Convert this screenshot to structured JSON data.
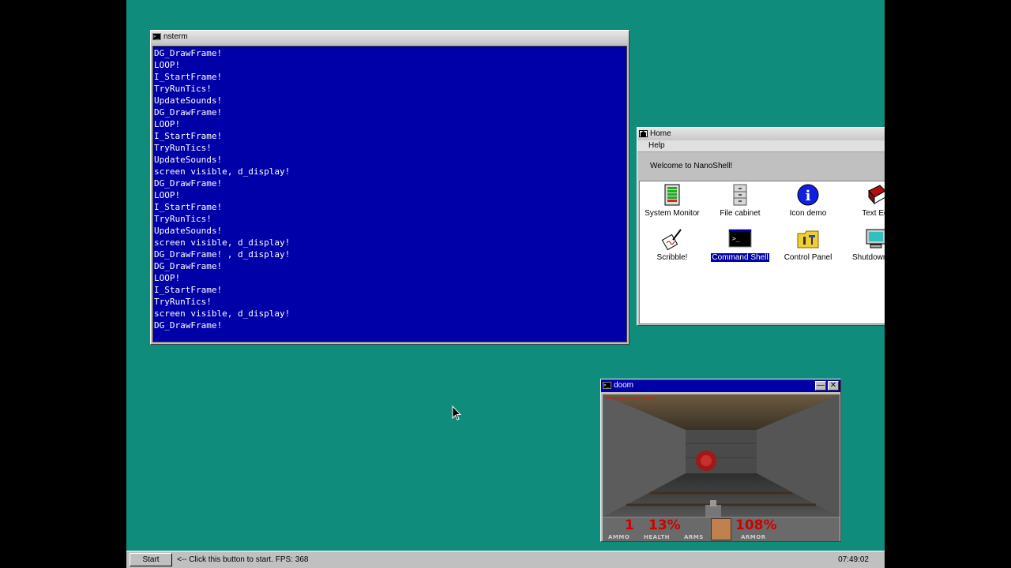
{
  "terminal": {
    "title": "nsterm",
    "lines": [
      "DG_DrawFrame!",
      "LOOP!",
      "I_StartFrame!",
      "TryRunTics!",
      "UpdateSounds!",
      "DG_DrawFrame!",
      "LOOP!",
      "I_StartFrame!",
      "TryRunTics!",
      "UpdateSounds!",
      "screen visible, d_display!",
      "DG_DrawFrame!",
      "LOOP!",
      "I_StartFrame!",
      "TryRunTics!",
      "UpdateSounds!",
      "screen visible, d_display!",
      "DG_DrawFrame! , d_display!",
      "DG_DrawFrame!",
      "LOOP!",
      "I_StartFrame!",
      "TryRunTics!",
      "screen visible, d_display!",
      "DG_DrawFrame!"
    ]
  },
  "home": {
    "title": "Home",
    "menu_help": "Help",
    "welcome": "Welcome to NanoShell!",
    "icons": [
      {
        "label": "System Monitor",
        "icon": "system-monitor-icon"
      },
      {
        "label": "File cabinet",
        "icon": "file-cabinet-icon"
      },
      {
        "label": "Icon demo",
        "icon": "info-icon"
      },
      {
        "label": "Text Edi",
        "icon": "text-editor-icon"
      },
      {
        "label": "Scribble!",
        "icon": "scribble-icon"
      },
      {
        "label": "Command Shell",
        "icon": "command-shell-icon",
        "selected": true
      },
      {
        "label": "Control Panel",
        "icon": "control-panel-icon"
      },
      {
        "label": "Shutdown Co",
        "icon": "shutdown-computer-icon"
      }
    ]
  },
  "doom": {
    "title": "doom",
    "minimize": "—",
    "close": "✕",
    "hud": {
      "ammo": "1",
      "ammo_label": "AMMO",
      "health": "13%",
      "health_label": "HEALTH",
      "arms_label": "ARMS",
      "armor": "108%",
      "armor_label": "ARMOR"
    }
  },
  "taskbar": {
    "start_label": "Start",
    "hint": "<-- Click this button to start.  FPS: 368",
    "clock": "07:49:02"
  },
  "colors": {
    "desktop": "#108c7c",
    "terminal_bg": "#0000a8",
    "window_gray": "#c0c0c0",
    "selection": "#0000a8"
  }
}
